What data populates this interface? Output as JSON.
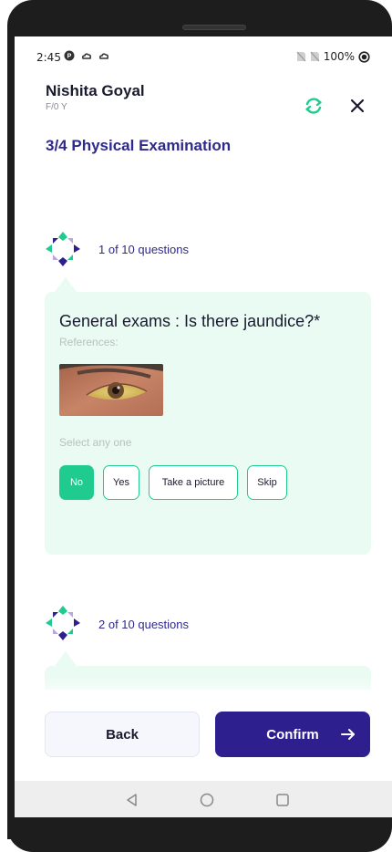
{
  "status_bar": {
    "time": "2:45",
    "battery": "100%"
  },
  "header": {
    "patient_name": "Nishita Goyal",
    "patient_sub": "F/0 Y",
    "section_title": "3/4 Physical Examination"
  },
  "question1": {
    "count": "1 of 10 questions",
    "text": "General exams : Is there jaundice?*",
    "references_label": "References:",
    "select_label": "Select any one",
    "options": [
      "No",
      "Yes",
      "Take a picture",
      "Skip"
    ],
    "selected": "No"
  },
  "question2": {
    "count": "2 of 10 questions"
  },
  "footer": {
    "back_label": "Back",
    "confirm_label": "Confirm"
  },
  "colors": {
    "accent_green": "#1fcb8e",
    "card_bg": "#e9fbf2",
    "primary": "#2e1f8f",
    "title": "#2e2a8a"
  },
  "icons": {
    "sync": "sync-icon",
    "close": "close-icon",
    "arrow": "arrow-right-icon"
  }
}
